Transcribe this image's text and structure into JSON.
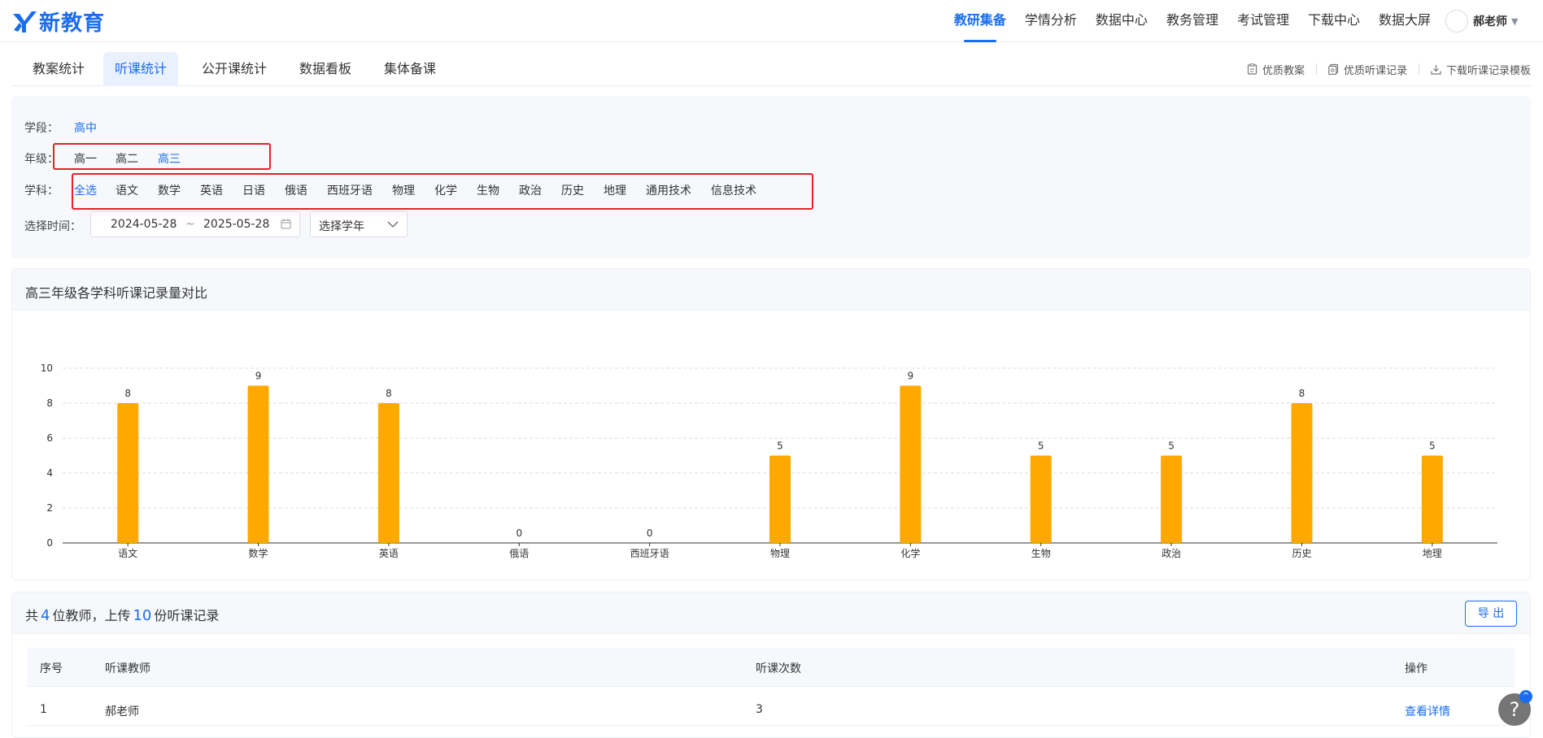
{
  "brand": {
    "name": "新教育",
    "color": "#1a6df0"
  },
  "nav": [
    {
      "label": "教研集备",
      "active": true
    },
    {
      "label": "学情分析"
    },
    {
      "label": "数据中心"
    },
    {
      "label": "教务管理"
    },
    {
      "label": "考试管理"
    },
    {
      "label": "下载中心"
    },
    {
      "label": "数据大屏"
    }
  ],
  "user": {
    "name": "郝老师"
  },
  "tabs": [
    {
      "label": "教案统计"
    },
    {
      "label": "听课统计",
      "active": true
    },
    {
      "label": "公开课统计"
    },
    {
      "label": "数据看板"
    },
    {
      "label": "集体备课"
    }
  ],
  "quick_links": [
    "优质教案",
    "优质听课记录",
    "下载听课记录模板"
  ],
  "filters": {
    "stage_label": "学段：",
    "stage_value": "高中",
    "grade_label": "年级：",
    "grades": [
      "高一",
      "高二",
      "高三"
    ],
    "selected_grade": "高三",
    "subject_label": "学科：",
    "subjects": [
      "全选",
      "语文",
      "数学",
      "英语",
      "日语",
      "俄语",
      "西班牙语",
      "物理",
      "化学",
      "生物",
      "政治",
      "历史",
      "地理",
      "通用技术",
      "信息技术"
    ],
    "selected_subject": "全选",
    "time_label": "选择时间：",
    "date_start": "2024-05-28",
    "date_sep": "~",
    "date_end": "2025-05-28",
    "year_placeholder": "选择学年"
  },
  "chart_title": "高三年级各学科听课记录量对比",
  "chart_data": {
    "type": "bar",
    "title": "高三年级各学科听课记录量对比",
    "categories": [
      "语文",
      "数学",
      "英语",
      "俄语",
      "西班牙语",
      "物理",
      "化学",
      "生物",
      "政治",
      "历史",
      "地理"
    ],
    "values": [
      8,
      9,
      8,
      0,
      0,
      5,
      9,
      5,
      5,
      8,
      5
    ],
    "ylim": [
      0,
      10
    ],
    "yticks": [
      0,
      2,
      4,
      6,
      8,
      10
    ],
    "grid": true,
    "data_labels": true,
    "bar_color": "#ffa800"
  },
  "summary": {
    "prefix": "共",
    "teacher_count": "4",
    "mid": "位教师，上传",
    "record_count": "10",
    "suffix": "份听课记录"
  },
  "export_label": "导 出",
  "table": {
    "headers": [
      "序号",
      "听课教师",
      "听课次数",
      "操作"
    ],
    "rows": [
      {
        "index": "1",
        "teacher": "郝老师",
        "count": "3",
        "action": "查看详情"
      }
    ]
  },
  "help": {
    "icon": "?",
    "badge": "^"
  }
}
